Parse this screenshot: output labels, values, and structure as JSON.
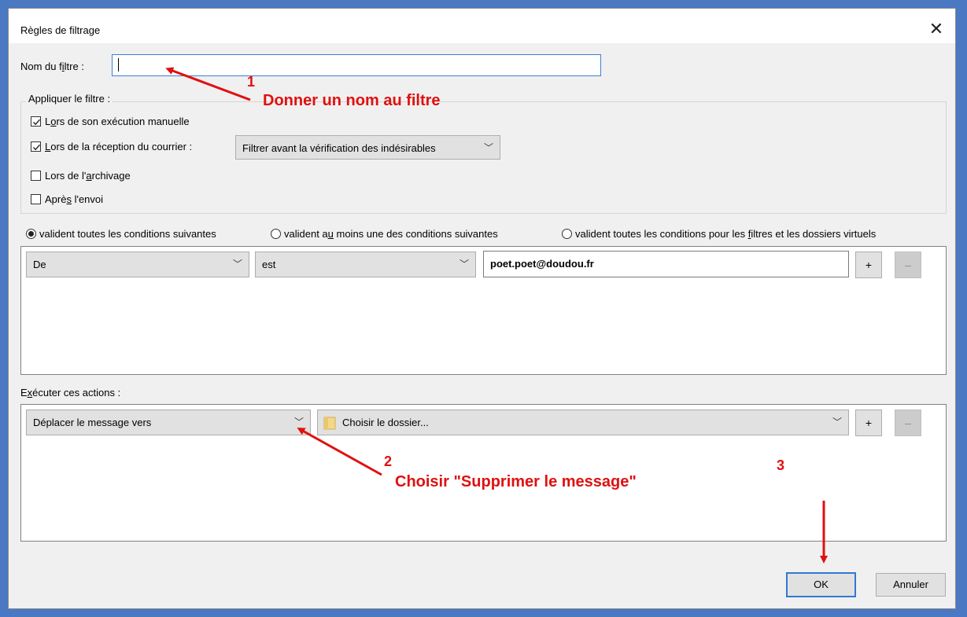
{
  "dialog": {
    "title": "Règles de filtrage",
    "close_symbol": "✕"
  },
  "filter_name": {
    "label": "Nom du filtre :",
    "value": ""
  },
  "apply": {
    "legend": "Appliquer le filtre :",
    "options": [
      {
        "label": "Lors de son exécution manuelle",
        "checked": true
      },
      {
        "label": "Lors de la réception du courrier :",
        "checked": true
      },
      {
        "label": "Lors de l'archivage",
        "checked": false
      },
      {
        "label": "Après l'envoi",
        "checked": false
      }
    ],
    "timing_select": "Filtrer avant la vérification des indésirables"
  },
  "match": {
    "options": [
      {
        "label": "valident toutes les conditions suivantes",
        "selected": true
      },
      {
        "label": "valident au moins une des conditions suivantes",
        "selected": false
      },
      {
        "label": "valident toutes les conditions pour les filtres et les dossiers virtuels",
        "selected": false
      }
    ]
  },
  "condition": {
    "field": "De",
    "operator": "est",
    "value": "poet.poet@doudou.fr",
    "add_label": "+",
    "remove_label": "–"
  },
  "actions": {
    "label": "Exécuter ces actions :",
    "action": "Déplacer le message vers",
    "folder": "Choisir le dossier...",
    "add_label": "+",
    "remove_label": "–"
  },
  "buttons": {
    "ok": "OK",
    "cancel": "Annuler"
  },
  "annotations": {
    "n1": "1",
    "text1": "Donner un nom au filtre",
    "n2": "2",
    "text2": "Choisir \"Supprimer le message\"",
    "n3": "3",
    "color": "#e01010"
  },
  "icons": {
    "folder": "folder-icon",
    "chevron": "chevron-down-icon",
    "close": "close-icon"
  }
}
